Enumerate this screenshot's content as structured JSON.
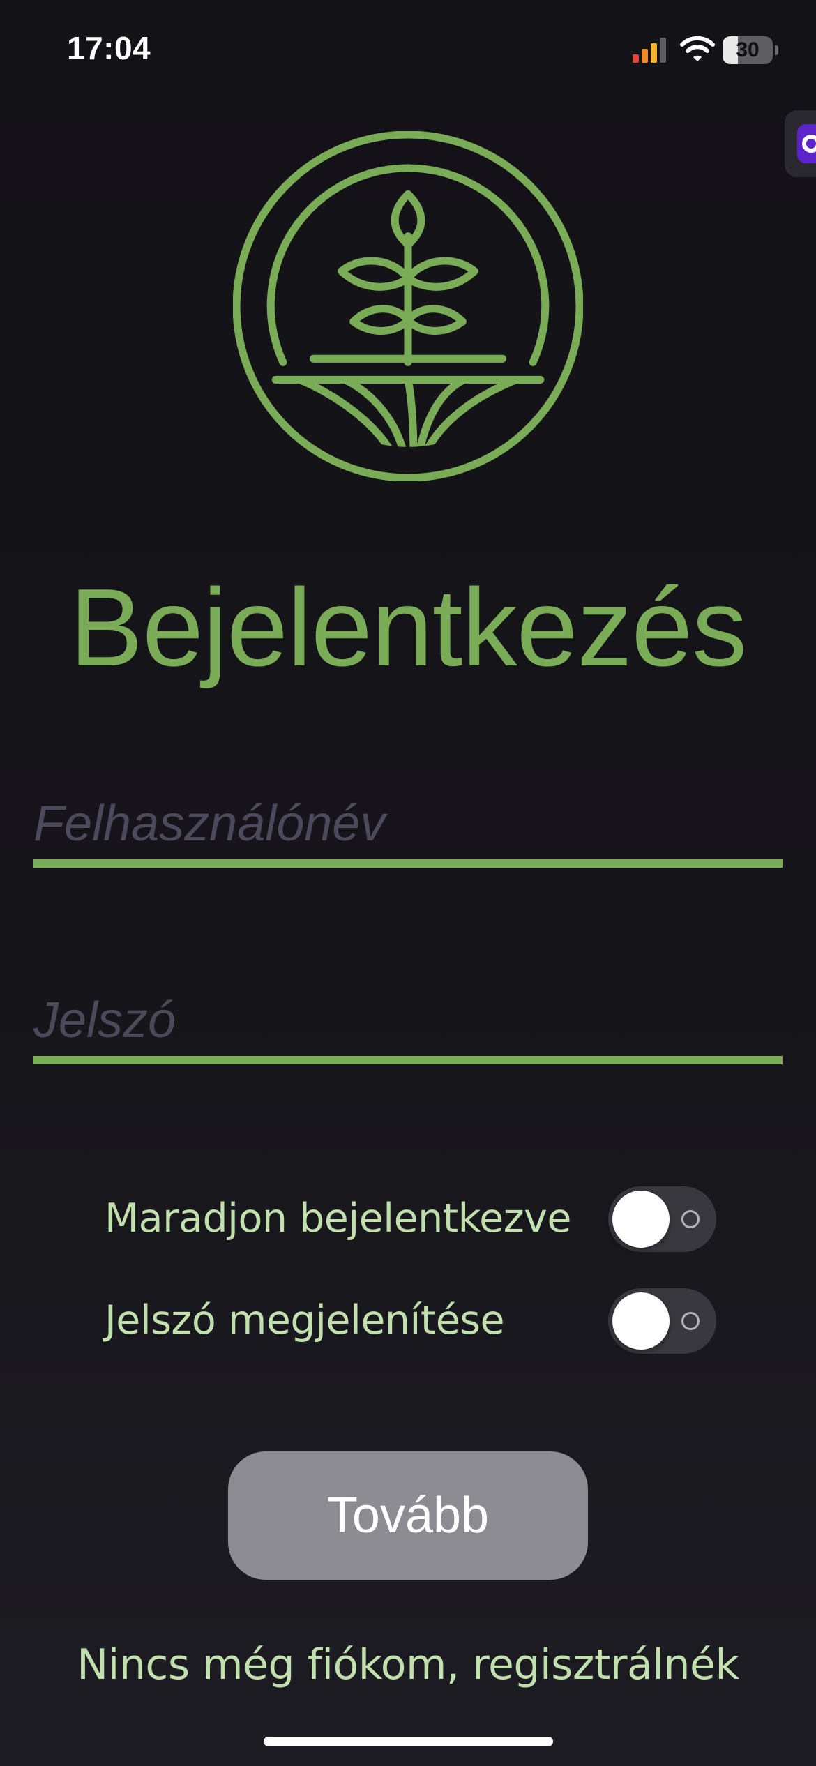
{
  "status_bar": {
    "time": "17:04",
    "battery_level": "30",
    "battery_fraction": 0.3,
    "signal_icon": "cellular-signal-icon",
    "wifi_icon": "wifi-icon",
    "battery_icon": "battery-icon"
  },
  "side_tab": {
    "icon": "floating-app-icon",
    "color": "#5b23c9"
  },
  "logo": {
    "icon": "plant-logo-icon",
    "color": "#7aab56"
  },
  "login": {
    "title": "Bejelentkezés",
    "username": {
      "placeholder": "Felhasználónév",
      "value": ""
    },
    "password": {
      "placeholder": "Jelszó",
      "value": ""
    },
    "toggles": [
      {
        "label": "Maradjon bejelentkezve",
        "on": false
      },
      {
        "label": "Jelszó megjelenítése",
        "on": false
      }
    ],
    "continue_label": "Tovább",
    "register_link": "Nincs még fiókom, regisztrálnék"
  },
  "colors": {
    "accent": "#7aab56",
    "label": "#c2dfae",
    "background": "#16151b",
    "button": "#8d8c93"
  }
}
